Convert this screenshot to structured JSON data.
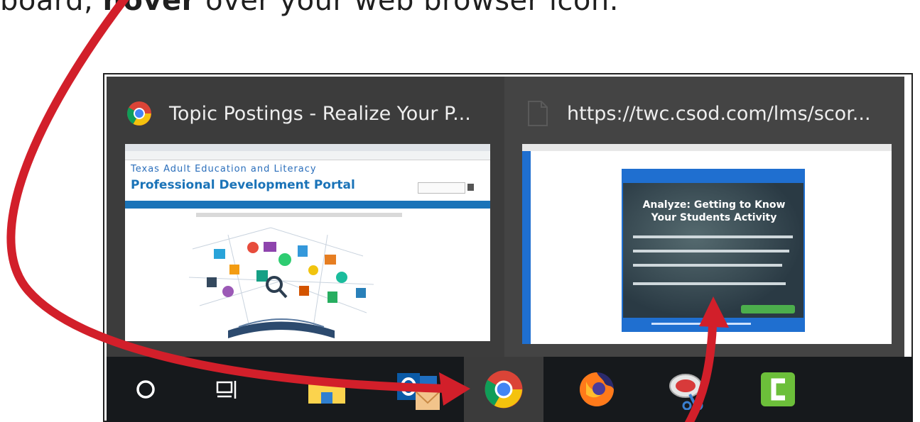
{
  "instruction": {
    "prefix": "board,",
    "emphasis": "hover",
    "suffix": "over your web browser icon."
  },
  "previews": [
    {
      "icon": "chrome-icon",
      "title": "Topic Postings - Realize Your P...",
      "page": {
        "heading_small": "Texas Adult Education and Literacy",
        "heading_large": "Professional Development Portal"
      }
    },
    {
      "icon": "blank-page-icon",
      "title": "https://twc.csod.com/lms/scor...",
      "page": {
        "slide_title": "Analyze: Getting to Know Your Students Activity"
      }
    }
  ],
  "taskbar": {
    "items": [
      {
        "name": "cortana-icon"
      },
      {
        "name": "task-view-icon"
      },
      {
        "name": "file-explorer-icon"
      },
      {
        "name": "outlook-icon"
      },
      {
        "name": "chrome-icon",
        "active": true
      },
      {
        "name": "firefox-icon"
      },
      {
        "name": "snipping-tool-icon"
      },
      {
        "name": "camtasia-icon"
      }
    ]
  },
  "colors": {
    "arrow": "#d21f2a",
    "preview_bg": "#3c3c3c",
    "taskbar_bg": "#16191c",
    "portal_blue": "#1a73b8",
    "camtasia_green": "#6cbf3a"
  }
}
